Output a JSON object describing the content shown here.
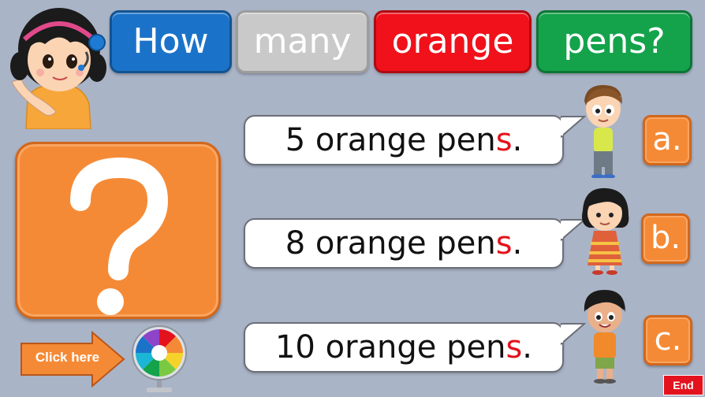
{
  "title_words": [
    "How",
    "many",
    "orange",
    "pens?"
  ],
  "question_symbol": "?",
  "answers": [
    {
      "letter": "a.",
      "text_main": "5 orange pen",
      "text_highlight": "s",
      "text_end": "."
    },
    {
      "letter": "b.",
      "text_main": "8 orange pen",
      "text_highlight": "s",
      "text_end": "."
    },
    {
      "letter": "c.",
      "text_main": "10 orange pen",
      "text_highlight": "s",
      "text_end": "."
    }
  ],
  "click_here_label": "Click here",
  "end_label": "End",
  "colors": {
    "background": "#aab4c7",
    "orange": "#f58a36",
    "blue": "#1b73c9",
    "gray": "#c9c9c9",
    "red": "#f0111b",
    "green": "#14a34b",
    "highlight": "#e3121d"
  },
  "icons": [
    "teacher-girl-avatar",
    "question-mark-icon",
    "boy-character",
    "girl-character",
    "boy-character-2",
    "color-wheel-icon",
    "arrow-right-icon"
  ]
}
